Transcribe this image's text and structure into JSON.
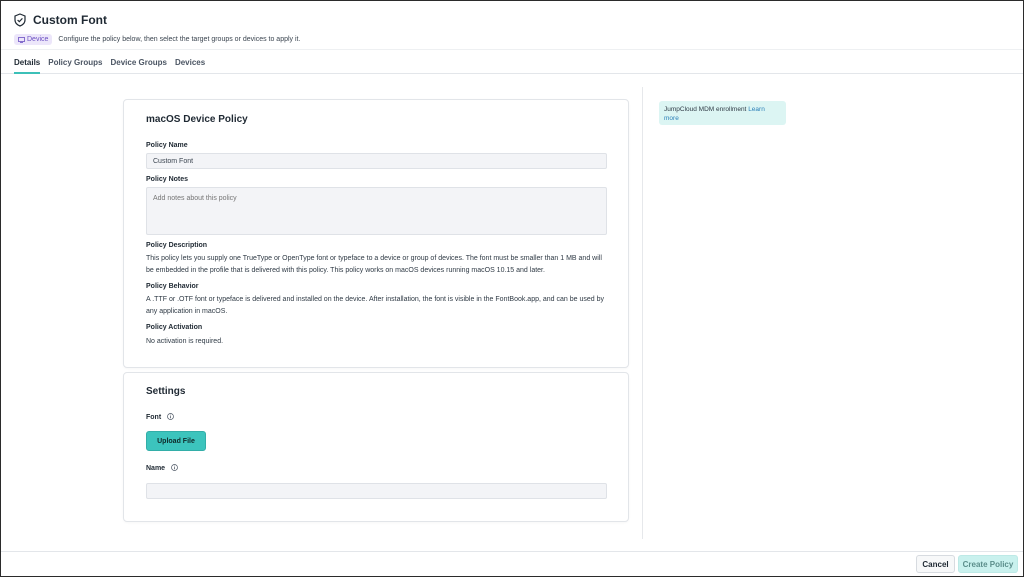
{
  "header": {
    "title": "Custom Font",
    "badge": "Device",
    "subtitle": "Configure the policy below, then select the target groups or devices to apply it."
  },
  "tabs": [
    {
      "label": "Details",
      "active": true
    },
    {
      "label": "Policy Groups",
      "active": false
    },
    {
      "label": "Device Groups",
      "active": false
    },
    {
      "label": "Devices",
      "active": false
    }
  ],
  "policy_card": {
    "title": "macOS Device Policy",
    "name_label": "Policy Name",
    "name_value": "Custom Font",
    "notes_label": "Policy Notes",
    "notes_placeholder": "Add notes about this policy",
    "description_label": "Policy Description",
    "description_text": "This policy lets you supply one TrueType or OpenType font or typeface to a device or group of devices. The font must be smaller than 1 MB and will be embedded in the profile that is delivered with this policy. This policy works on macOS devices running macOS 10.15 and later.",
    "behavior_label": "Policy Behavior",
    "behavior_text": "A .TTF or .OTF font or typeface is delivered and installed on the device. After installation, the font is visible in the FontBook.app, and can be used by any application in macOS.",
    "activation_label": "Policy Activation",
    "activation_text": "No activation is required."
  },
  "settings_card": {
    "title": "Settings",
    "font_label": "Font",
    "upload_label": "Upload File",
    "name_label": "Name",
    "name_value": ""
  },
  "side_note": {
    "text": "JumpCloud MDM enrollment",
    "link": "Learn more"
  },
  "footer": {
    "cancel_label": "Cancel",
    "create_label": "Create Policy"
  },
  "colors": {
    "accent": "#3cc4bd",
    "badge_bg": "#ece6fa",
    "badge_text": "#6b4fc2",
    "note_bg": "#dcf5f3",
    "create_disabled_bg": "#c9f1ee"
  },
  "icons": {
    "title_icon": "shield-check-icon",
    "badge_icon": "device-icon",
    "info_icon": "info-icon"
  }
}
